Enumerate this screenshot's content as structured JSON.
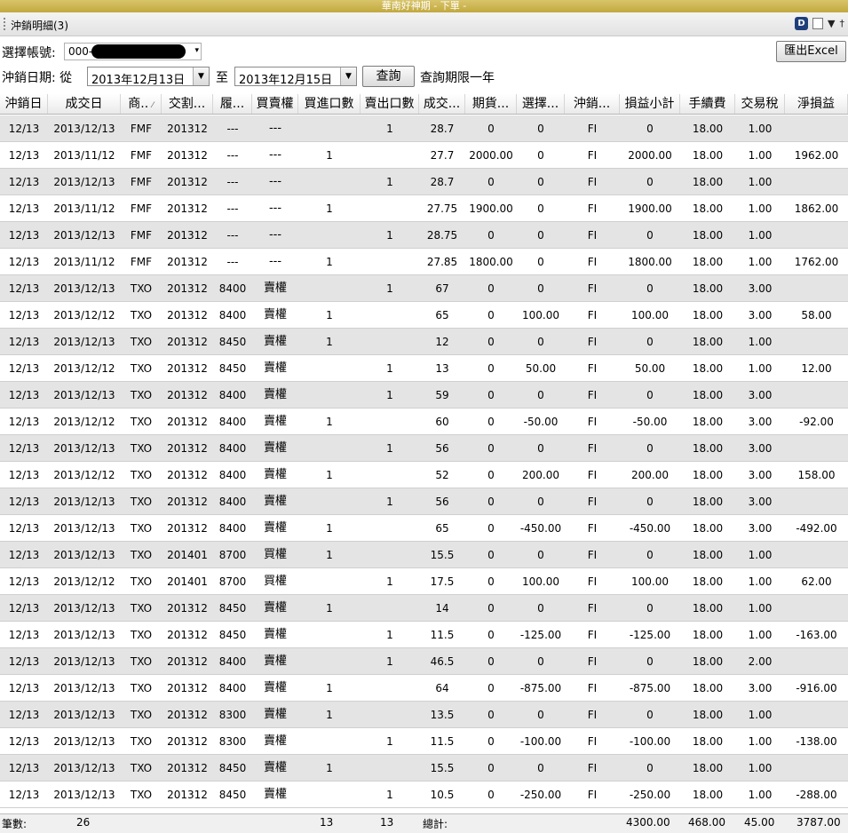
{
  "window": {
    "title": "華南好神期 - 下單 -"
  },
  "panel": {
    "title": "沖銷明細(3)",
    "d_label": "D",
    "dropdown_glyph": "▼",
    "pin_glyph": "†"
  },
  "account": {
    "label": "選擇帳號:",
    "prefix": "000-",
    "arrow": "▾"
  },
  "export_button": "匯出Excel",
  "date_filter": {
    "label": "沖銷日期: 從",
    "from": "2013年12月13日",
    "to_label": "至",
    "to": "2013年12月15日",
    "arrow": "▼",
    "query_button": "查詢",
    "note": "查詢期限一年"
  },
  "columns": [
    "沖銷日",
    "成交日",
    "商..",
    "交割...",
    "履...",
    "買賣權",
    "買進口數",
    "賣出口數",
    "成交...",
    "期貨...",
    "選擇...",
    "沖銷...",
    "損益小計",
    "手續費",
    "交易稅",
    "淨損益"
  ],
  "sort_glyph": "⁄",
  "rows": [
    [
      "12/13",
      "2013/12/13",
      "FMF",
      "201312",
      "---",
      "---",
      "",
      "1",
      "28.7",
      "0",
      "0",
      "FI",
      "0",
      "18.00",
      "1.00",
      ""
    ],
    [
      "12/13",
      "2013/11/12",
      "FMF",
      "201312",
      "---",
      "---",
      "1",
      "",
      "27.7",
      "2000.00",
      "0",
      "FI",
      "2000.00",
      "18.00",
      "1.00",
      "1962.00"
    ],
    [
      "12/13",
      "2013/12/13",
      "FMF",
      "201312",
      "---",
      "---",
      "",
      "1",
      "28.7",
      "0",
      "0",
      "FI",
      "0",
      "18.00",
      "1.00",
      ""
    ],
    [
      "12/13",
      "2013/11/12",
      "FMF",
      "201312",
      "---",
      "---",
      "1",
      "",
      "27.75",
      "1900.00",
      "0",
      "FI",
      "1900.00",
      "18.00",
      "1.00",
      "1862.00"
    ],
    [
      "12/13",
      "2013/12/13",
      "FMF",
      "201312",
      "---",
      "---",
      "",
      "1",
      "28.75",
      "0",
      "0",
      "FI",
      "0",
      "18.00",
      "1.00",
      ""
    ],
    [
      "12/13",
      "2013/11/12",
      "FMF",
      "201312",
      "---",
      "---",
      "1",
      "",
      "27.85",
      "1800.00",
      "0",
      "FI",
      "1800.00",
      "18.00",
      "1.00",
      "1762.00"
    ],
    [
      "12/13",
      "2013/12/13",
      "TXO",
      "201312",
      "8400",
      "賣權",
      "",
      "1",
      "67",
      "0",
      "0",
      "FI",
      "0",
      "18.00",
      "3.00",
      ""
    ],
    [
      "12/13",
      "2013/12/12",
      "TXO",
      "201312",
      "8400",
      "賣權",
      "1",
      "",
      "65",
      "0",
      "100.00",
      "FI",
      "100.00",
      "18.00",
      "3.00",
      "58.00"
    ],
    [
      "12/13",
      "2013/12/13",
      "TXO",
      "201312",
      "8450",
      "賣權",
      "1",
      "",
      "12",
      "0",
      "0",
      "FI",
      "0",
      "18.00",
      "1.00",
      ""
    ],
    [
      "12/13",
      "2013/12/12",
      "TXO",
      "201312",
      "8450",
      "賣權",
      "",
      "1",
      "13",
      "0",
      "50.00",
      "FI",
      "50.00",
      "18.00",
      "1.00",
      "12.00"
    ],
    [
      "12/13",
      "2013/12/13",
      "TXO",
      "201312",
      "8400",
      "賣權",
      "",
      "1",
      "59",
      "0",
      "0",
      "FI",
      "0",
      "18.00",
      "3.00",
      ""
    ],
    [
      "12/13",
      "2013/12/12",
      "TXO",
      "201312",
      "8400",
      "賣權",
      "1",
      "",
      "60",
      "0",
      "-50.00",
      "FI",
      "-50.00",
      "18.00",
      "3.00",
      "-92.00"
    ],
    [
      "12/13",
      "2013/12/13",
      "TXO",
      "201312",
      "8400",
      "賣權",
      "",
      "1",
      "56",
      "0",
      "0",
      "FI",
      "0",
      "18.00",
      "3.00",
      ""
    ],
    [
      "12/13",
      "2013/12/12",
      "TXO",
      "201312",
      "8400",
      "賣權",
      "1",
      "",
      "52",
      "0",
      "200.00",
      "FI",
      "200.00",
      "18.00",
      "3.00",
      "158.00"
    ],
    [
      "12/13",
      "2013/12/13",
      "TXO",
      "201312",
      "8400",
      "賣權",
      "",
      "1",
      "56",
      "0",
      "0",
      "FI",
      "0",
      "18.00",
      "3.00",
      ""
    ],
    [
      "12/13",
      "2013/12/13",
      "TXO",
      "201312",
      "8400",
      "賣權",
      "1",
      "",
      "65",
      "0",
      "-450.00",
      "FI",
      "-450.00",
      "18.00",
      "3.00",
      "-492.00"
    ],
    [
      "12/13",
      "2013/12/13",
      "TXO",
      "201401",
      "8700",
      "買權",
      "1",
      "",
      "15.5",
      "0",
      "0",
      "FI",
      "0",
      "18.00",
      "1.00",
      ""
    ],
    [
      "12/13",
      "2013/12/12",
      "TXO",
      "201401",
      "8700",
      "買權",
      "",
      "1",
      "17.5",
      "0",
      "100.00",
      "FI",
      "100.00",
      "18.00",
      "1.00",
      "62.00"
    ],
    [
      "12/13",
      "2013/12/13",
      "TXO",
      "201312",
      "8450",
      "賣權",
      "1",
      "",
      "14",
      "0",
      "0",
      "FI",
      "0",
      "18.00",
      "1.00",
      ""
    ],
    [
      "12/13",
      "2013/12/13",
      "TXO",
      "201312",
      "8450",
      "賣權",
      "",
      "1",
      "11.5",
      "0",
      "-125.00",
      "FI",
      "-125.00",
      "18.00",
      "1.00",
      "-163.00"
    ],
    [
      "12/13",
      "2013/12/13",
      "TXO",
      "201312",
      "8400",
      "賣權",
      "",
      "1",
      "46.5",
      "0",
      "0",
      "FI",
      "0",
      "18.00",
      "2.00",
      ""
    ],
    [
      "12/13",
      "2013/12/13",
      "TXO",
      "201312",
      "8400",
      "賣權",
      "1",
      "",
      "64",
      "0",
      "-875.00",
      "FI",
      "-875.00",
      "18.00",
      "3.00",
      "-916.00"
    ],
    [
      "12/13",
      "2013/12/13",
      "TXO",
      "201312",
      "8300",
      "賣權",
      "1",
      "",
      "13.5",
      "0",
      "0",
      "FI",
      "0",
      "18.00",
      "1.00",
      ""
    ],
    [
      "12/13",
      "2013/12/13",
      "TXO",
      "201312",
      "8300",
      "賣權",
      "",
      "1",
      "11.5",
      "0",
      "-100.00",
      "FI",
      "-100.00",
      "18.00",
      "1.00",
      "-138.00"
    ],
    [
      "12/13",
      "2013/12/13",
      "TXO",
      "201312",
      "8450",
      "賣權",
      "1",
      "",
      "15.5",
      "0",
      "0",
      "FI",
      "0",
      "18.00",
      "1.00",
      ""
    ],
    [
      "12/13",
      "2013/12/13",
      "TXO",
      "201312",
      "8450",
      "賣權",
      "",
      "1",
      "10.5",
      "0",
      "-250.00",
      "FI",
      "-250.00",
      "18.00",
      "1.00",
      "-288.00"
    ]
  ],
  "footer": {
    "count_label": "筆數:",
    "count": "26",
    "buy_total": "13",
    "sell_total": "13",
    "total_label": "總計:",
    "pl_total": "4300.00",
    "fee_total": "468.00",
    "tax_total": "45.00",
    "net_total": "3787.00"
  }
}
